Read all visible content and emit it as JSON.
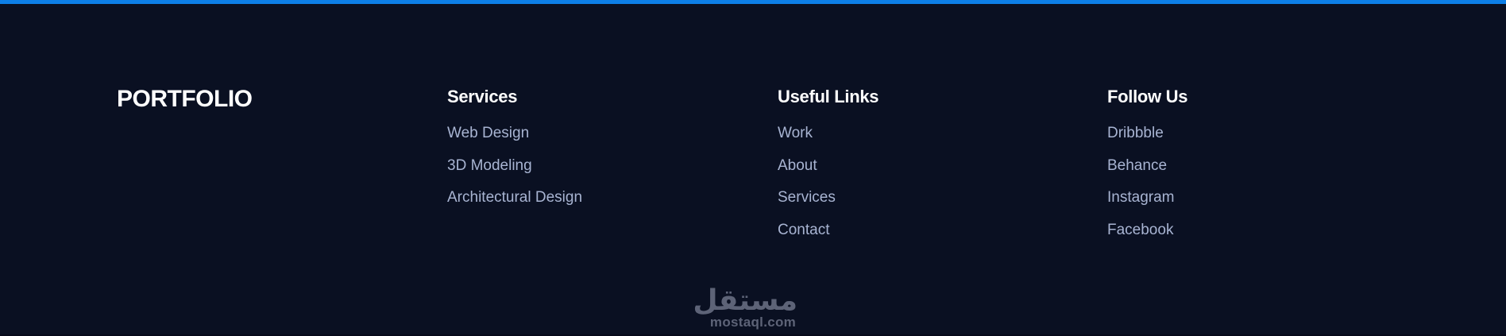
{
  "brand": "PORTFOLIO",
  "accent_color": "#0d7fe8",
  "background_color": "#0a1022",
  "services": {
    "heading": "Services",
    "items": [
      "Web Design",
      "3D Modeling",
      "Architectural Design"
    ]
  },
  "useful_links": {
    "heading": "Useful Links",
    "items": [
      "Work",
      "About",
      "Services",
      "Contact"
    ]
  },
  "follow_us": {
    "heading": "Follow Us",
    "items": [
      "Dribbble",
      "Behance",
      "Instagram",
      "Facebook"
    ]
  },
  "watermark": {
    "arabic": "مستقل",
    "latin": "mostaql.com"
  }
}
